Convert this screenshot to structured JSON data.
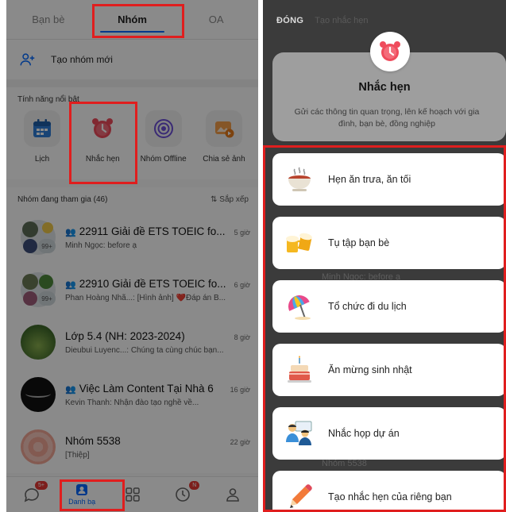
{
  "left": {
    "tabs": [
      {
        "label": "Bạn bè",
        "active": false
      },
      {
        "label": "Nhóm",
        "active": true
      },
      {
        "label": "OA",
        "active": false
      }
    ],
    "create_group": "Tạo nhóm mới",
    "features_title": "Tính năng nổi bật",
    "features": [
      {
        "label": "Lịch",
        "icon": "calendar-icon"
      },
      {
        "label": "Nhắc hẹn",
        "icon": "alarm-clock-icon"
      },
      {
        "label": "Nhóm Offline",
        "icon": "radar-icon"
      },
      {
        "label": "Chia sẻ ảnh",
        "icon": "photo-share-icon"
      }
    ],
    "groups_header": "Nhóm đang tham gia (46)",
    "sort_label": "Sắp xếp",
    "groups": [
      {
        "name": "22911 Giải đề ETS TOEIC fo...",
        "time": "5 giờ",
        "message": "Minh Ngọc: before ạ",
        "community": true,
        "count": "99+"
      },
      {
        "name": "22910 Giải đề ETS TOEIC fo...",
        "time": "6 giờ",
        "message": "Phan Hoàng Nhã...: [Hình ảnh] ❤️Đáp án B...",
        "community": true,
        "count": "99+"
      },
      {
        "name": "Lớp 5.4 (NH: 2023-2024)",
        "time": "8 giờ",
        "message": "Dieubui Luyenc...: Chúng ta cùng chúc bạn...",
        "community": false
      },
      {
        "name": "Việc Làm Content Tại Nhà 6",
        "time": "16 giờ",
        "message": "Kevin Thanh: Nhận đào tạo nghề về...",
        "community": true
      },
      {
        "name": "Nhóm 5538",
        "time": "22 giờ",
        "message": "[Thiệp]",
        "community": false
      }
    ],
    "bottom_nav": {
      "messages_badge": "5+",
      "contacts_label": "Danh bạ",
      "timeline_badge": "N"
    }
  },
  "right": {
    "close_label": "ĐÓNG",
    "ghost_header": "Tạo nhắc hẹn",
    "title": "Nhắc hẹn",
    "description": "Gửi các thông tin quan trọng, lên kế hoạch với gia đình, bạn bè, đồng nghiệp",
    "options": [
      {
        "label": "Hẹn ăn trưa, ăn tối",
        "icon": "food-bowl-icon"
      },
      {
        "label": "Tụ tập bạn bè",
        "icon": "beer-mugs-icon"
      },
      {
        "label": "Tổ chức đi du lịch",
        "icon": "beach-umbrella-icon"
      },
      {
        "label": "Ăn mừng sinh nhật",
        "icon": "birthday-cake-icon"
      },
      {
        "label": "Nhắc họp dự án",
        "icon": "meeting-people-icon"
      },
      {
        "label": "Tạo nhắc hẹn của riêng bạn",
        "icon": "pencil-icon"
      }
    ],
    "ghost_rows": [
      "Minh Ngọc: before ạ",
      "Nhóm 5538"
    ]
  },
  "colors": {
    "accent": "#0068ff",
    "highlight": "#e01e1e",
    "reminder": "#ef4b5c"
  }
}
